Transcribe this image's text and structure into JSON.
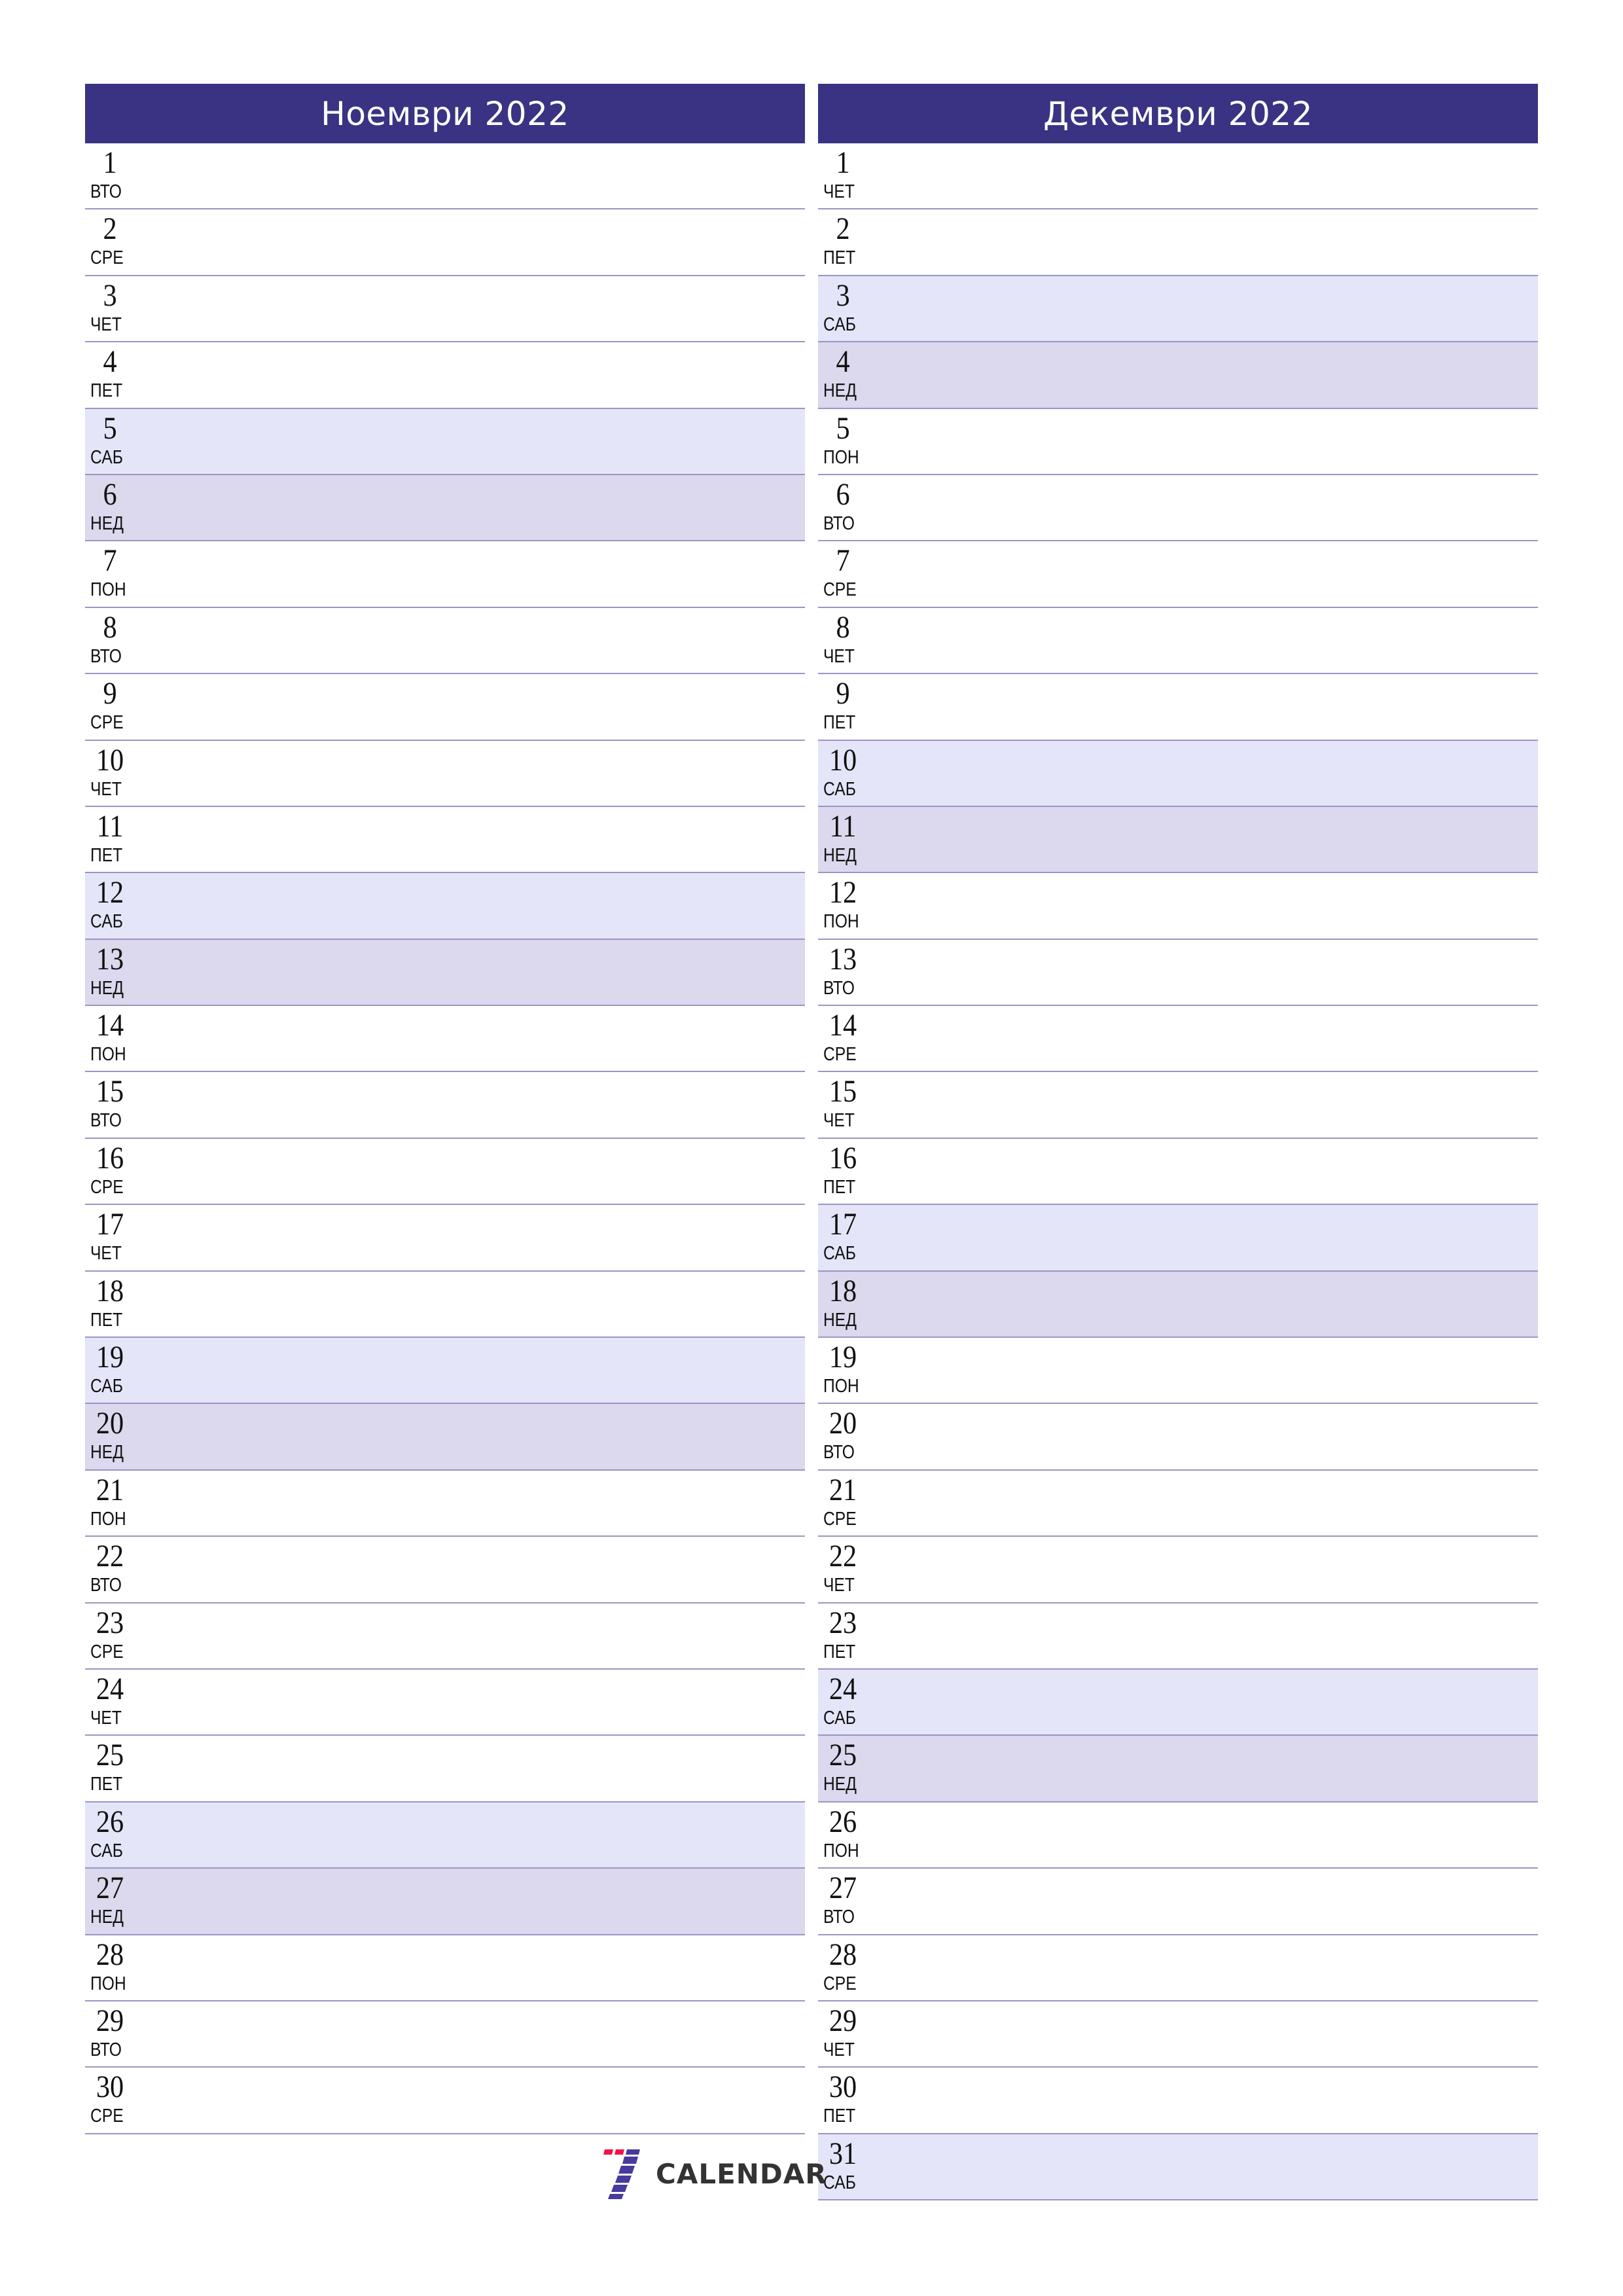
{
  "colors": {
    "header": "#3a3282",
    "saturday": "#e4e5f8",
    "sunday": "#dcd8ed",
    "divider": "#9a95c6",
    "logo_red": "#f0144a",
    "logo_purple": "#473a9e"
  },
  "months": [
    {
      "title": "Ноември 2022",
      "days": [
        {
          "n": "1",
          "d": "ВТО"
        },
        {
          "n": "2",
          "d": "СРЕ"
        },
        {
          "n": "3",
          "d": "ЧЕТ"
        },
        {
          "n": "4",
          "d": "ПЕТ"
        },
        {
          "n": "5",
          "d": "САБ"
        },
        {
          "n": "6",
          "d": "НЕД"
        },
        {
          "n": "7",
          "d": "ПОН"
        },
        {
          "n": "8",
          "d": "ВТО"
        },
        {
          "n": "9",
          "d": "СРЕ"
        },
        {
          "n": "10",
          "d": "ЧЕТ"
        },
        {
          "n": "11",
          "d": "ПЕТ"
        },
        {
          "n": "12",
          "d": "САБ"
        },
        {
          "n": "13",
          "d": "НЕД"
        },
        {
          "n": "14",
          "d": "ПОН"
        },
        {
          "n": "15",
          "d": "ВТО"
        },
        {
          "n": "16",
          "d": "СРЕ"
        },
        {
          "n": "17",
          "d": "ЧЕТ"
        },
        {
          "n": "18",
          "d": "ПЕТ"
        },
        {
          "n": "19",
          "d": "САБ"
        },
        {
          "n": "20",
          "d": "НЕД"
        },
        {
          "n": "21",
          "d": "ПОН"
        },
        {
          "n": "22",
          "d": "ВТО"
        },
        {
          "n": "23",
          "d": "СРЕ"
        },
        {
          "n": "24",
          "d": "ЧЕТ"
        },
        {
          "n": "25",
          "d": "ПЕТ"
        },
        {
          "n": "26",
          "d": "САБ"
        },
        {
          "n": "27",
          "d": "НЕД"
        },
        {
          "n": "28",
          "d": "ПОН"
        },
        {
          "n": "29",
          "d": "ВТО"
        },
        {
          "n": "30",
          "d": "СРЕ"
        }
      ]
    },
    {
      "title": "Декември 2022",
      "days": [
        {
          "n": "1",
          "d": "ЧЕТ"
        },
        {
          "n": "2",
          "d": "ПЕТ"
        },
        {
          "n": "3",
          "d": "САБ"
        },
        {
          "n": "4",
          "d": "НЕД"
        },
        {
          "n": "5",
          "d": "ПОН"
        },
        {
          "n": "6",
          "d": "ВТО"
        },
        {
          "n": "7",
          "d": "СРЕ"
        },
        {
          "n": "8",
          "d": "ЧЕТ"
        },
        {
          "n": "9",
          "d": "ПЕТ"
        },
        {
          "n": "10",
          "d": "САБ"
        },
        {
          "n": "11",
          "d": "НЕД"
        },
        {
          "n": "12",
          "d": "ПОН"
        },
        {
          "n": "13",
          "d": "ВТО"
        },
        {
          "n": "14",
          "d": "СРЕ"
        },
        {
          "n": "15",
          "d": "ЧЕТ"
        },
        {
          "n": "16",
          "d": "ПЕТ"
        },
        {
          "n": "17",
          "d": "САБ"
        },
        {
          "n": "18",
          "d": "НЕД"
        },
        {
          "n": "19",
          "d": "ПОН"
        },
        {
          "n": "20",
          "d": "ВТО"
        },
        {
          "n": "21",
          "d": "СРЕ"
        },
        {
          "n": "22",
          "d": "ЧЕТ"
        },
        {
          "n": "23",
          "d": "ПЕТ"
        },
        {
          "n": "24",
          "d": "САБ"
        },
        {
          "n": "25",
          "d": "НЕД"
        },
        {
          "n": "26",
          "d": "ПОН"
        },
        {
          "n": "27",
          "d": "ВТО"
        },
        {
          "n": "28",
          "d": "СРЕ"
        },
        {
          "n": "29",
          "d": "ЧЕТ"
        },
        {
          "n": "30",
          "d": "ПЕТ"
        },
        {
          "n": "31",
          "d": "САБ"
        }
      ]
    }
  ],
  "weekend": {
    "saturday": "САБ",
    "sunday": "НЕД"
  },
  "logo": {
    "icon": "seven-logo-icon",
    "text": "CALENDAR"
  }
}
